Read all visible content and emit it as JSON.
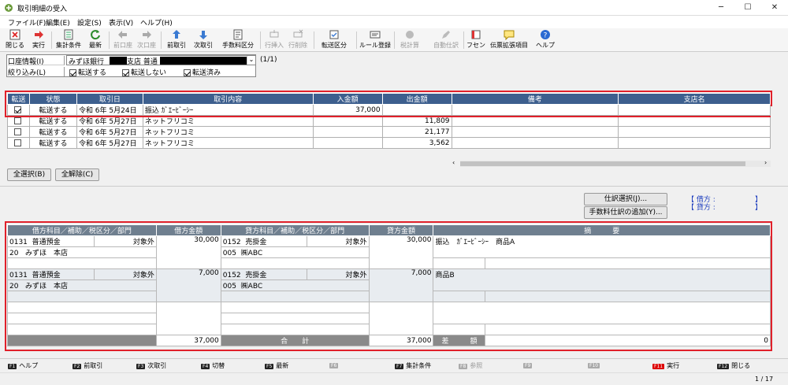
{
  "window": {
    "title": "取引明細の受入"
  },
  "menu": [
    "ファイル(F)",
    "編集(E)",
    "設定(S)",
    "表示(V)",
    "ヘルプ(H)"
  ],
  "toolbar": {
    "close": "閉じる",
    "run": "実行",
    "aggregate": "集計条件",
    "refresh": "最新",
    "prev_account": "前口座",
    "next_account": "次口座",
    "prev_txn": "前取引",
    "next_txn": "次取引",
    "fee_class": "手数料区分",
    "insert_row": "行挿入",
    "delete_row": "行削除",
    "transfer_class": "転送区分",
    "rule_register": "ルール登録",
    "tax_calc": "税計算",
    "auto_journal": "自動仕訳",
    "sticky": "フセン",
    "voucher_ext": "伝票拡張項目",
    "help": "ヘルプ"
  },
  "filter": {
    "account_label": "口座情報(I)",
    "account_value": "みずほ銀行",
    "account_branch": "支店 普通",
    "account_page": "(1/1)",
    "narrow_label": "絞り込み(L)",
    "opt_transfer": "転送する",
    "opt_no_transfer": "転送しない",
    "opt_transferred": "転送済み"
  },
  "grid": {
    "headers": [
      "転送",
      "状態",
      "取引日",
      "取引内容",
      "入金額",
      "出金額",
      "備考",
      "支店名"
    ],
    "rows": [
      {
        "checked": true,
        "status": "転送する",
        "date": "令和 6年 5月24日",
        "content": "振込 ｶﾞｴｰﾋﾞｰｼｰ",
        "deposit": "37,000",
        "withdraw": ""
      },
      {
        "checked": false,
        "status": "転送する",
        "date": "令和 6年 5月27日",
        "content": "ネットフリコミ",
        "deposit": "",
        "withdraw": "11,809"
      },
      {
        "checked": false,
        "status": "転送する",
        "date": "令和 6年 5月27日",
        "content": "ネットフリコミ",
        "deposit": "",
        "withdraw": "21,177"
      },
      {
        "checked": false,
        "status": "転送する",
        "date": "令和 6年 5月27日",
        "content": "ネットフリコミ",
        "deposit": "",
        "withdraw": "3,562"
      }
    ]
  },
  "buttons": {
    "select_all": "全選択(B)",
    "deselect_all": "全解除(C)",
    "journal_select": "仕訳選択(J)...",
    "add_fee_journal": "手数料仕訳の追加(Y)..."
  },
  "balance": {
    "debit_label": "【 借方 :",
    "credit_label": "【 貸方 :",
    "close": "】"
  },
  "journal": {
    "headers": [
      "借方科目／補助／税区分／部門",
      "借方金額",
      "貸方科目／補助／税区分／部門",
      "貸方金額",
      "摘　　　要"
    ],
    "entries": [
      {
        "dr_code": "0131",
        "dr_name": "普通預金",
        "dr_tax": "対象外",
        "dr_sub_code": "20",
        "dr_sub": "みずほ　本店",
        "dr_amount": "30,000",
        "cr_code": "0152",
        "cr_name": "売掛金",
        "cr_tax": "対象外",
        "cr_sub_code": "005",
        "cr_sub": "㈱ABC",
        "cr_amount": "30,000",
        "memo": "振込　ｶﾞｴｰﾋﾞｰｼｰ　商品A"
      },
      {
        "dr_code": "0131",
        "dr_name": "普通預金",
        "dr_tax": "対象外",
        "dr_sub_code": "20",
        "dr_sub": "みずほ　本店",
        "dr_amount": "7,000",
        "cr_code": "0152",
        "cr_name": "売掛金",
        "cr_tax": "対象外",
        "cr_sub_code": "005",
        "cr_sub": "㈱ABC",
        "cr_amount": "7,000",
        "memo": "商品B"
      }
    ],
    "total_label": "合　　計",
    "dr_total": "37,000",
    "cr_total": "37,000",
    "diff_label": "差　　　額",
    "diff": "0"
  },
  "fkeys": [
    {
      "key": "F1",
      "label": "ヘルプ"
    },
    {
      "key": "F2",
      "label": "前取引"
    },
    {
      "key": "F3",
      "label": "次取引"
    },
    {
      "key": "F4",
      "label": "切替"
    },
    {
      "key": "F5",
      "label": "最新"
    },
    {
      "key": "F6",
      "label": ""
    },
    {
      "key": "F7",
      "label": "集計条件"
    },
    {
      "key": "F8",
      "label": "参照"
    },
    {
      "key": "F9",
      "label": ""
    },
    {
      "key": "F10",
      "label": ""
    },
    {
      "key": "F11",
      "label": "実行"
    },
    {
      "key": "F12",
      "label": "閉じる"
    }
  ],
  "status": {
    "page": "1 / 17"
  }
}
